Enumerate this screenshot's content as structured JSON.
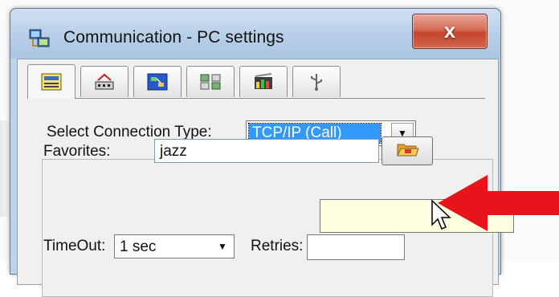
{
  "window": {
    "title": "Communication - PC settings",
    "close_label": "x"
  },
  "tabs": [
    {
      "name": "tab-calculator",
      "icon": "calculator-icon"
    },
    {
      "name": "tab-device",
      "icon": "device-icon"
    },
    {
      "name": "tab-network",
      "icon": "network-icon"
    },
    {
      "name": "tab-transfer",
      "icon": "transfer-icon"
    },
    {
      "name": "tab-signal",
      "icon": "signal-icon"
    },
    {
      "name": "tab-usb",
      "icon": "usb-icon"
    }
  ],
  "connection": {
    "label": "Select Connection Type:",
    "selected": "TCP/IP (Call)"
  },
  "favorites": {
    "label": "Favorites:",
    "value": "jazz",
    "browse_icon": "folder-open-icon"
  },
  "timeout": {
    "label": "TimeOut:",
    "value": "1 sec"
  },
  "retries": {
    "label": "Retries:"
  },
  "colors": {
    "accent": "#3399ff",
    "arrow": "#e8141b",
    "close": "#c2432b"
  }
}
